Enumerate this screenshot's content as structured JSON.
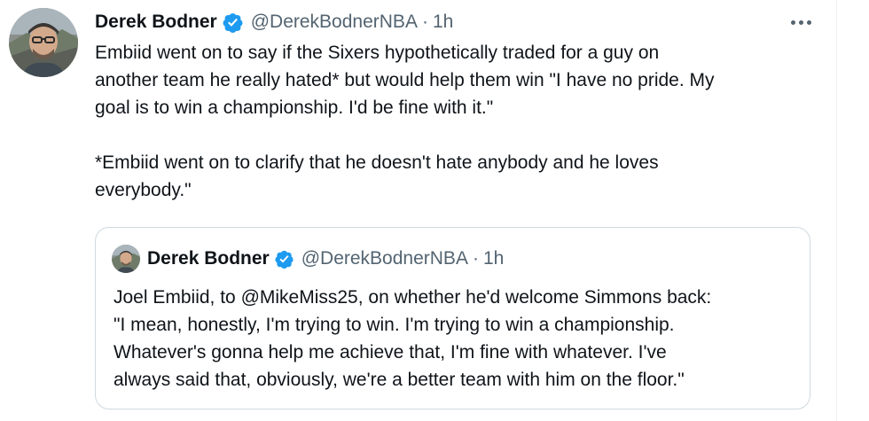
{
  "tweet": {
    "author_name": "Derek Bodner",
    "handle": "@DerekBodnerNBA",
    "separator": "·",
    "time": "1h",
    "text_lines": [
      "Embiid went on to say if the Sixers hypothetically traded for a guy on",
      "another team he really hated* but would help them win \"I have no pride. My",
      "goal is to win a championship. I'd be fine with it.\"",
      "*Embiid went on to clarify that he doesn't hate anybody and he loves",
      "everybody.\""
    ]
  },
  "quoted_tweet": {
    "author_name": "Derek Bodner",
    "handle": "@DerekBodnerNBA",
    "separator": "·",
    "time": "1h",
    "text_lines": [
      "Joel Embiid, to @MikeMiss25, on whether he'd welcome Simmons back:",
      "\"I mean, honestly, I'm trying to win. I'm trying to win a championship.",
      "Whatever's gonna help me achieve that, I'm fine with whatever. I've",
      "always said that, obviously, we're a better team with him on the floor.\""
    ]
  },
  "icons": {
    "verified": "verified-badge-icon",
    "more": "more-options-icon"
  },
  "colors": {
    "verified_blue": "#1d9bf0",
    "secondary_text": "#536471",
    "primary_text": "#0f1419",
    "border": "#cfd9de"
  }
}
